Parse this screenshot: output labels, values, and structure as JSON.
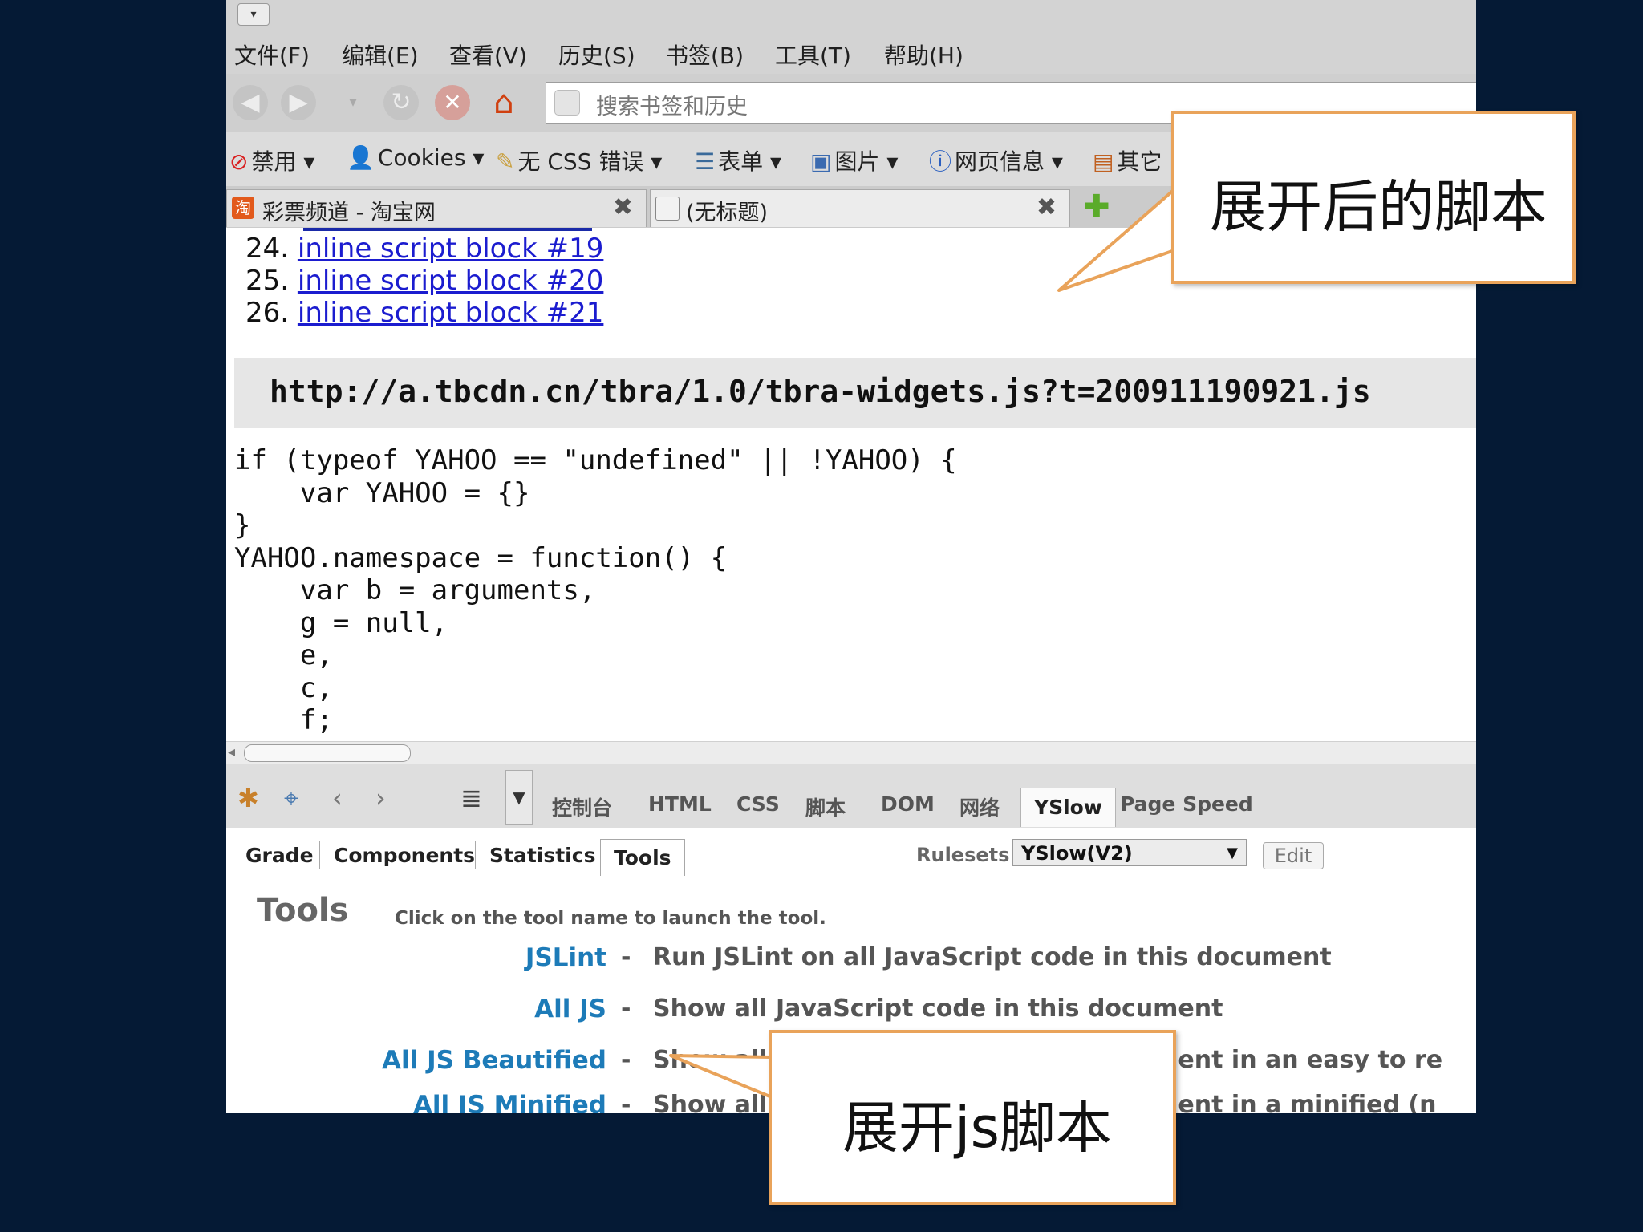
{
  "menubar": {
    "items": [
      "文件(F)",
      "编辑(E)",
      "查看(V)",
      "历史(S)",
      "书签(B)",
      "工具(T)",
      "帮助(H)"
    ]
  },
  "navbar": {
    "search_placeholder": "搜索书签和历史"
  },
  "devbar": {
    "items": [
      {
        "label": "禁用 ▾",
        "icon": "no-entry-icon"
      },
      {
        "label": "Cookies ▾",
        "icon": "user-icon"
      },
      {
        "label": "无 CSS 错误 ▾",
        "icon": "pencil-icon"
      },
      {
        "label": "表单 ▾",
        "icon": "form-icon"
      },
      {
        "label": "图片 ▾",
        "icon": "image-icon"
      },
      {
        "label": "网页信息 ▾",
        "icon": "info-icon"
      },
      {
        "label": "其它",
        "icon": "misc-icon"
      }
    ]
  },
  "tabs": [
    {
      "label": "彩票频道 - 淘宝网",
      "icon": "taobao-icon",
      "favicon_text": "淘"
    },
    {
      "label": "(无标题)",
      "icon": "page-icon"
    }
  ],
  "content": {
    "script_items": [
      {
        "num": "24.",
        "link": "inline script block #19"
      },
      {
        "num": "25.",
        "link": "inline script block #20"
      },
      {
        "num": "26.",
        "link": "inline script block #21"
      }
    ],
    "url": "http://a.tbcdn.cn/tbra/1.0/tbra-widgets.js?t=200911190921.js",
    "code": "if (typeof YAHOO == \"undefined\" || !YAHOO) {\n    var YAHOO = {}\n}\nYAHOO.namespace = function() {\n    var b = arguments,\n    g = null,\n    e,\n    c,\n    f;"
  },
  "firebug": {
    "tabs": [
      "控制台",
      "HTML",
      "CSS",
      "脚本",
      "DOM",
      "网络",
      "YSlow",
      "Page Speed"
    ],
    "active_tab": "YSlow"
  },
  "yslow": {
    "tabs": [
      "Grade",
      "Components",
      "Statistics",
      "Tools"
    ],
    "active_tab": "Tools",
    "rulesets_label": "Rulesets",
    "ruleset_value": "YSlow(V2)",
    "edit_label": "Edit",
    "tools_title": "Tools",
    "tools_desc": "Click on the tool name to launch the tool.",
    "tools": [
      {
        "name": "JSLint",
        "desc": "Run JSLint on all JavaScript code in this document"
      },
      {
        "name": "All JS",
        "desc": "Show all JavaScript code in this document"
      },
      {
        "name": "All JS Beautified",
        "desc": "Show all JavaScript code in this document in an easy to re"
      },
      {
        "name": "All JS Minified",
        "desc": "Show all JavaScript code in this document in a minified (n"
      }
    ]
  },
  "callouts": {
    "expanded_script": "展开后的脚本",
    "expand_js": "展开js脚本"
  },
  "colors": {
    "background": "#051a35",
    "callout_border": "#e9a35a",
    "link": "#1b1ccf",
    "tool_link": "#1d7bb8"
  }
}
